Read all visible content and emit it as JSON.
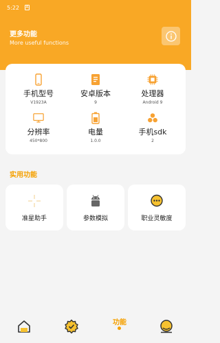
{
  "status_bar": {
    "time": "5:22",
    "sim_glyph": "A"
  },
  "header": {
    "title": "更多功能",
    "subtitle": "More useful functions",
    "info_icon": "info-icon"
  },
  "device_specs": [
    {
      "label": "手机型号",
      "value": "V1923A",
      "icon": "phone-icon"
    },
    {
      "label": "安卓版本",
      "value": "9",
      "icon": "document-icon"
    },
    {
      "label": "处理器",
      "value": "Android 9",
      "icon": "chip-icon"
    },
    {
      "label": "分辨率",
      "value": "450*800",
      "icon": "monitor-icon"
    },
    {
      "label": "电量",
      "value": "1.0.0",
      "icon": "battery-icon"
    },
    {
      "label": "手机sdk",
      "value": "2",
      "icon": "sdk-icon"
    }
  ],
  "tools_section": {
    "title": "实用功能",
    "items": [
      {
        "label": "准星助手",
        "icon": "crosshair-icon"
      },
      {
        "label": "参数模拟",
        "icon": "android-icon"
      },
      {
        "label": "职业灵敏度",
        "icon": "chat-bubble-icon"
      }
    ]
  },
  "bottom_nav": {
    "items": [
      {
        "icon": "home-icon"
      },
      {
        "icon": "settings-gear-icon"
      },
      {
        "label": "功能",
        "active": true
      },
      {
        "icon": "profile-icon"
      }
    ]
  },
  "colors": {
    "accent": "#f9a825",
    "accent_text": "#f5a000",
    "icon_orange": "#f7a233"
  }
}
